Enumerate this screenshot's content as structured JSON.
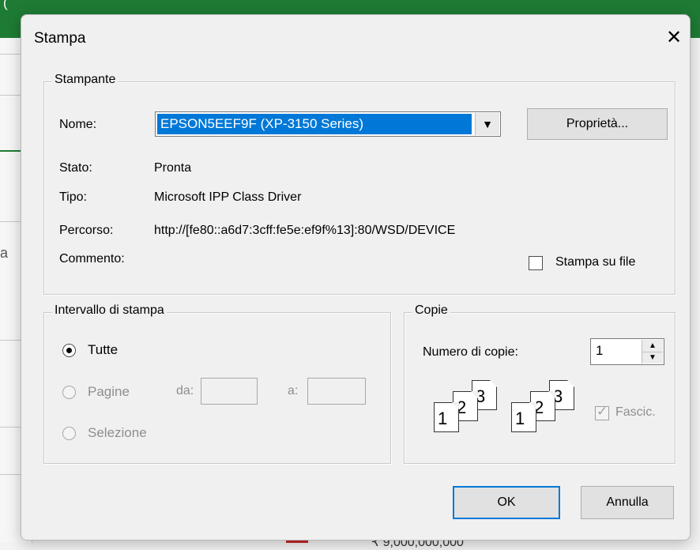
{
  "dialog": {
    "title": "Stampa",
    "close_glyph": "✕"
  },
  "printer_group": {
    "legend": "Stampante",
    "name_label": "Nome:",
    "name_value": "EPSON5EEF9F (XP-3150 Series)",
    "properties_button": "Proprietà...",
    "status_label": "Stato:",
    "status_value": "Pronta",
    "type_label": "Tipo:",
    "type_value": "Microsoft IPP Class Driver",
    "path_label": "Percorso:",
    "path_value": "http://[fe80::a6d7:3cff:fe5e:ef9f%13]:80/WSD/DEVICE",
    "comment_label": "Commento:",
    "print_to_file_label": "Stampa su file",
    "print_to_file_checked": false
  },
  "range_group": {
    "legend": "Intervallo di stampa",
    "all_label": "Tutte",
    "pages_label": "Pagine",
    "from_label": "da:",
    "to_label": "a:",
    "selection_label": "Selezione",
    "selected": "all"
  },
  "copies_group": {
    "legend": "Copie",
    "count_label": "Numero di copie:",
    "count_value": "1",
    "collate_label": "Fascic.",
    "collate_checked": true,
    "page_numbers": [
      "1",
      "2",
      "3"
    ]
  },
  "buttons": {
    "ok": "OK",
    "cancel": "Annulla"
  },
  "background": {
    "caption": "(",
    "sidebar_letter": "a",
    "bottom_text": "₹ 9,000,000,000"
  }
}
